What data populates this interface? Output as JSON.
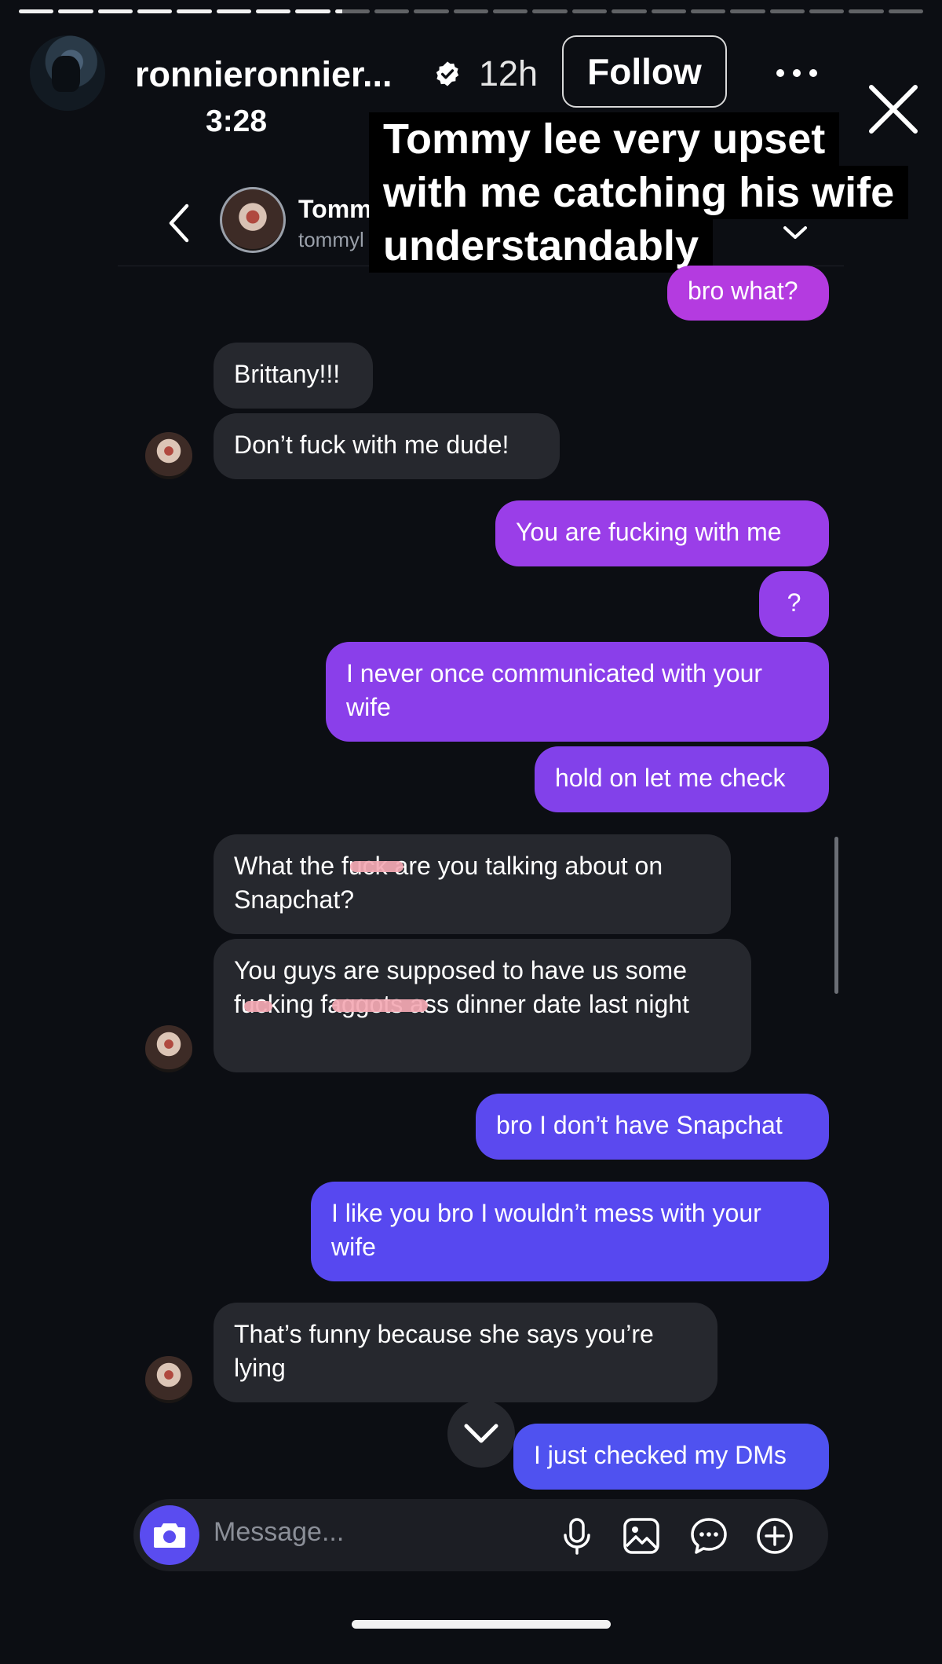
{
  "story": {
    "progress_segments_total": 23,
    "progress_segments_done": 9,
    "username": "ronnieronnier...",
    "age": "12h",
    "follow_label": "Follow",
    "status_time": "3:28"
  },
  "sticker": {
    "lines": [
      "Tommy lee very upset",
      "with me catching his wife",
      "understandably"
    ]
  },
  "chat": {
    "contact_name": "Tomm",
    "contact_handle": "tommyl",
    "messages": [
      {
        "dir": "out",
        "text": "bro what?"
      },
      {
        "dir": "in",
        "text": "Brittany!!!"
      },
      {
        "dir": "in",
        "text": "Don’t fuck with me dude!"
      },
      {
        "dir": "out",
        "text": "You are fucking with me"
      },
      {
        "dir": "out",
        "text": "?"
      },
      {
        "dir": "out",
        "text": "I never once communicated with your wife"
      },
      {
        "dir": "out",
        "text": "hold on let me check"
      },
      {
        "dir": "in",
        "text": "What the fuck are you talking about on Snapchat?"
      },
      {
        "dir": "in",
        "text": "You guys are supposed to have us some fucking faggots ass dinner date last night"
      },
      {
        "dir": "out",
        "text": "bro I don’t have Snapchat"
      },
      {
        "dir": "out",
        "text": "I like you bro I wouldn’t mess with your wife"
      },
      {
        "dir": "in",
        "text": "That’s funny because she says you’re lying"
      },
      {
        "dir": "out",
        "text": "I just checked my DMs"
      }
    ],
    "composer_placeholder": "Message..."
  },
  "colors": {
    "background": "#0c0e13",
    "incoming_bubble": "#26282e",
    "outgoing_top": "#b43be0",
    "outgoing_bottom": "#4f52f0",
    "camera_button": "#5a4cf0",
    "redaction": "#f4a9b4"
  },
  "icons": [
    "verified-badge-icon",
    "more-icon",
    "close-icon",
    "back-chevron-icon",
    "chevron-down-icon",
    "camera-icon",
    "microphone-icon",
    "gallery-icon",
    "sticker-icon",
    "plus-icon"
  ]
}
